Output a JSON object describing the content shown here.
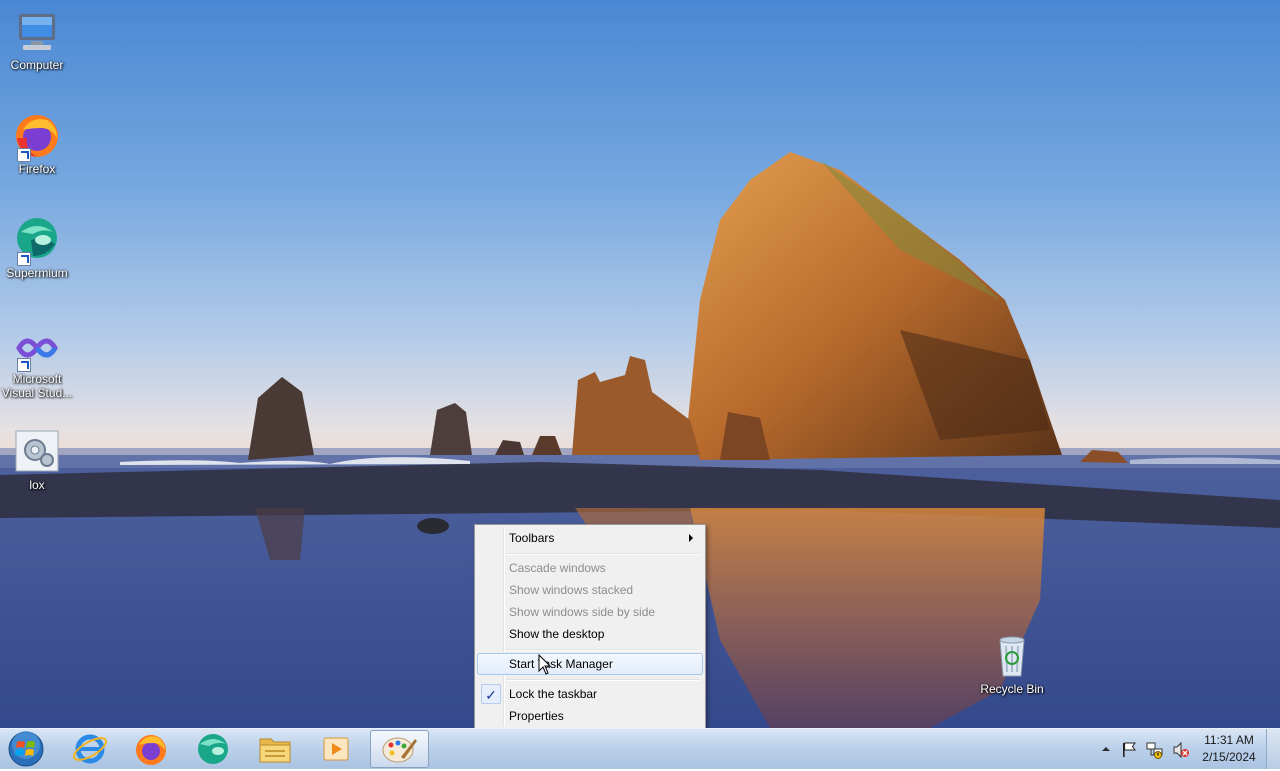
{
  "desktop": {
    "icons": [
      {
        "label": "Computer"
      },
      {
        "label": "Firefox"
      },
      {
        "label": "Supermium"
      },
      {
        "label": "Microsoft Visual Stud..."
      },
      {
        "label": "lox"
      },
      {
        "label": "Recycle Bin"
      }
    ]
  },
  "context_menu": {
    "items": [
      {
        "label": "Toolbars",
        "submenu": true,
        "enabled": true
      },
      {
        "label": "Cascade windows",
        "enabled": false
      },
      {
        "label": "Show windows stacked",
        "enabled": false
      },
      {
        "label": "Show windows side by side",
        "enabled": false
      },
      {
        "label": "Show the desktop",
        "enabled": true
      },
      {
        "label": "Start Task Manager",
        "enabled": true,
        "highlighted": true
      },
      {
        "label": "Lock the taskbar",
        "enabled": true,
        "checked": true
      },
      {
        "label": "Properties",
        "enabled": true
      }
    ],
    "check_glyph": "✓"
  },
  "taskbar": {
    "pinned_apps": [
      {
        "icon": "internet-explorer-icon"
      },
      {
        "icon": "firefox-icon"
      },
      {
        "icon": "supermium-icon"
      },
      {
        "icon": "file-explorer-icon"
      },
      {
        "icon": "media-player-icon"
      },
      {
        "icon": "paint-icon",
        "active": true
      }
    ],
    "tray": {
      "icons": [
        "show-hidden-icons-icon",
        "action-center-flag-icon",
        "network-icon",
        "volume-muted-icon"
      ]
    },
    "clock": {
      "time": "11:31 AM",
      "date": "2/15/2024"
    }
  },
  "colors": {
    "accent": "#1d3b8b",
    "taskbar": "#bcd1ea",
    "menu_bg": "#f0f0f0"
  }
}
